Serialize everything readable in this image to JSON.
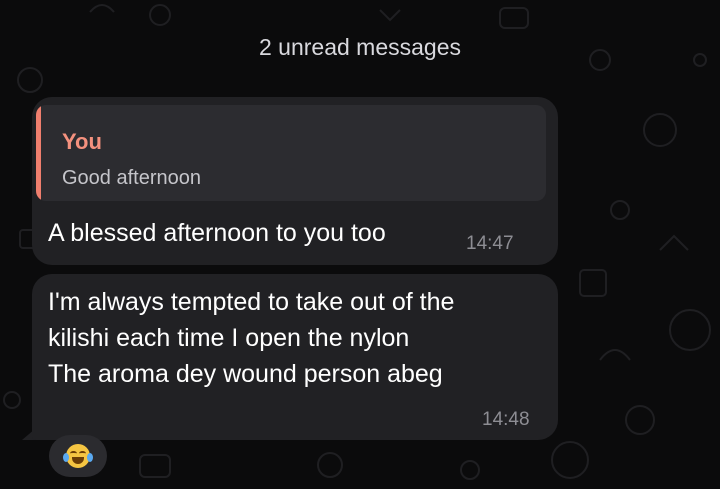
{
  "chat": {
    "unread_banner": "2 unread messages",
    "messages": [
      {
        "reply_to": {
          "author": "You",
          "text": "Good afternoon"
        },
        "text": "A blessed afternoon to you too",
        "time": "14:47"
      },
      {
        "text": "I'm always tempted to take out of the\nkilishi each time I open the nylon\nThe aroma dey wound person abeg",
        "time": "14:48",
        "reaction": "face-with-tears-of-joy-emoji"
      }
    ]
  },
  "colors": {
    "background": "#0b0b0c",
    "bubble": "#212124",
    "quote_accent": "#f07f6e",
    "timestamp": "#8d8d93"
  }
}
